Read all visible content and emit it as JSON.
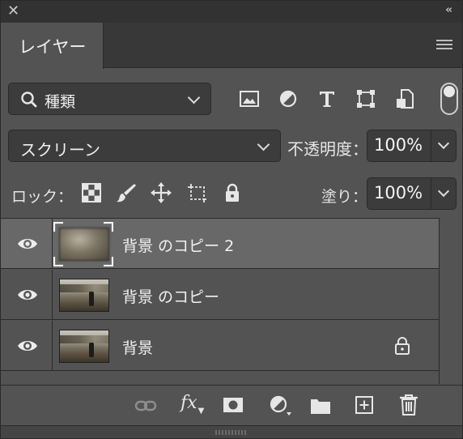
{
  "panel": {
    "tab_title": "レイヤー"
  },
  "filter": {
    "kind_label": "種類",
    "tools": [
      "image-filter-icon",
      "adjustment-filter-icon",
      "type-filter-icon",
      "shape-filter-icon",
      "smart-object-filter-icon"
    ]
  },
  "blend": {
    "mode": "スクリーン",
    "opacity_label": "不透明度：",
    "opacity_value": "100%"
  },
  "lock": {
    "label": "ロック：",
    "fill_label": "塗り：",
    "fill_value": "100%"
  },
  "layers": [
    {
      "name": "背景 のコピー 2",
      "selected": true,
      "locked": false,
      "visible": true
    },
    {
      "name": "背景 のコピー",
      "selected": false,
      "locked": false,
      "visible": true
    },
    {
      "name": "背景",
      "selected": false,
      "locked": true,
      "visible": true
    }
  ],
  "bottom_tools": {
    "fx_label": "fx"
  },
  "colors": {
    "panel_bg": "#535353",
    "selected_row": "#686868",
    "field_bg": "#3c3c3c"
  }
}
